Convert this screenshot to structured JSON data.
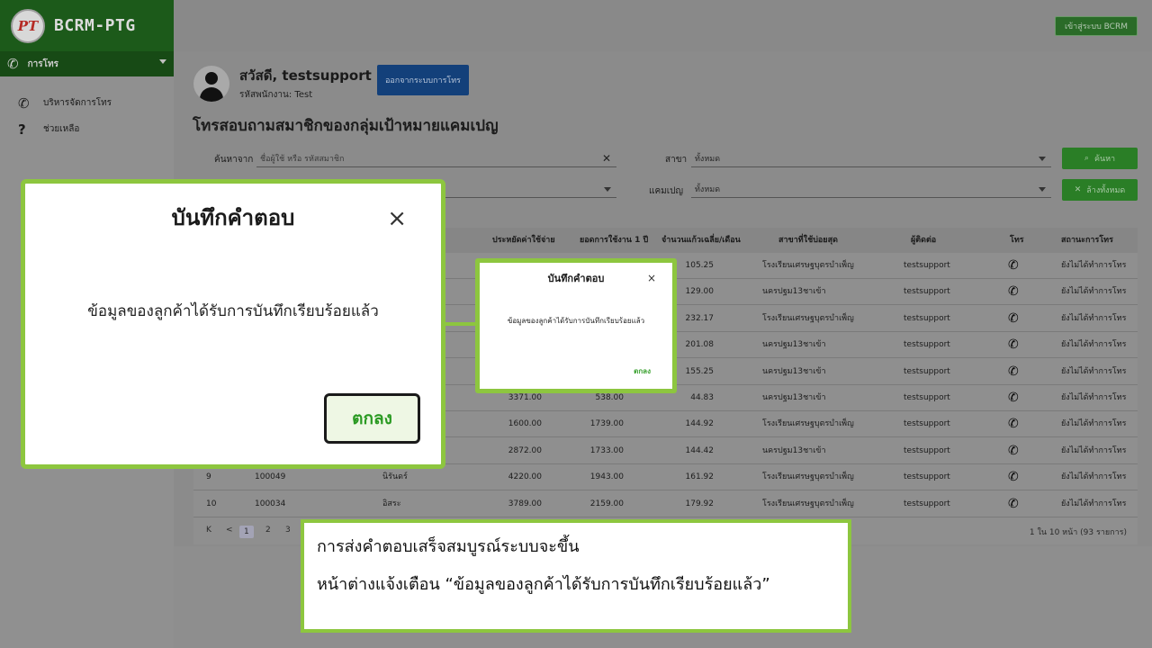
{
  "brand": {
    "logo_text": "PT",
    "name": "BCRM-PTG"
  },
  "sidebar": {
    "header": "การโทร",
    "items": [
      {
        "label": "บริหารจัดการโทร",
        "icon": "phone-icon"
      },
      {
        "label": "ช่วยเหลือ",
        "icon": "help-icon"
      }
    ]
  },
  "topbar": {
    "login_button": "เข้าสู่ระบบ BCRM"
  },
  "user": {
    "greeting": "สวัสดี, testsupport",
    "employee_id": "รหัสพนักงาน: Test",
    "logout_button": "ออกจากระบบการโทร"
  },
  "page": {
    "title": "โทรสอบถามสมาชิกของกลุ่มเป้าหมายแคมเปญ"
  },
  "filters": {
    "search_label": "ค้นหาจาก",
    "search_placeholder": "ชื่อผู้ใช้ หรือ รหัสสมาชิก",
    "branch_label": "สาขา",
    "branch_value": "ทั้งหมด",
    "campaign_label": "แคมเปญ",
    "campaign_value": "ทั้งหมด",
    "search_button": "ค้นหา",
    "clear_button": "ล้างทั้งหมด"
  },
  "table": {
    "headers": [
      "ประหยัดค่าใช้จ่าย",
      "ยอดการใช้งาน 1 ปี",
      "จำนวนแก้วเฉลี่ย/เดือน",
      "สาขาที่ใช้บ่อยสุด",
      "ผู้ติดต่อ",
      "โทร",
      "สถานะการโทร"
    ],
    "rows": [
      {
        "no": "",
        "id": "",
        "name": "",
        "saving": "",
        "usage": "",
        "avg": "105.25",
        "branch": "โรงเรียนเศรษฐบุตรบำเพ็ญ",
        "contact": "testsupport",
        "status": "ยังไม่ได้ทำการโทร"
      },
      {
        "no": "",
        "id": "",
        "name": "",
        "saving": "",
        "usage": "",
        "avg": "129.00",
        "branch": "นครปฐม13ชาเข้า",
        "contact": "testsupport",
        "status": "ยังไม่ได้ทำการโทร"
      },
      {
        "no": "",
        "id": "",
        "name": "",
        "saving": "",
        "usage": "",
        "avg": "232.17",
        "branch": "โรงเรียนเศรษฐบุตรบำเพ็ญ",
        "contact": "testsupport",
        "status": "ยังไม่ได้ทำการโทร"
      },
      {
        "no": "",
        "id": "",
        "name": "",
        "saving": "",
        "usage": "",
        "avg": "201.08",
        "branch": "นครปฐม13ชาเข้า",
        "contact": "testsupport",
        "status": "ยังไม่ได้ทำการโทร"
      },
      {
        "no": "",
        "id": "",
        "name": "",
        "saving": "",
        "usage": "",
        "avg": "155.25",
        "branch": "นครปฐม13ชาเข้า",
        "contact": "testsupport",
        "status": "ยังไม่ได้ทำการโทร"
      },
      {
        "no": "",
        "id": "",
        "name": "",
        "saving": "3371.00",
        "usage": "538.00",
        "avg": "44.83",
        "branch": "นครปฐม13ชาเข้า",
        "contact": "testsupport",
        "status": "ยังไม่ได้ทำการโทร"
      },
      {
        "no": "",
        "id": "",
        "name": "",
        "saving": "1600.00",
        "usage": "1739.00",
        "avg": "144.92",
        "branch": "โรงเรียนเศรษฐบุตรบำเพ็ญ",
        "contact": "testsupport",
        "status": "ยังไม่ได้ทำการโทร"
      },
      {
        "no": "",
        "id": "",
        "name": "",
        "saving": "2872.00",
        "usage": "1733.00",
        "avg": "144.42",
        "branch": "นครปฐม13ชาเข้า",
        "contact": "testsupport",
        "status": "ยังไม่ได้ทำการโทร"
      },
      {
        "no": "9",
        "id": "100049",
        "name": "นิรันดร์",
        "saving": "4220.00",
        "usage": "1943.00",
        "avg": "161.92",
        "branch": "โรงเรียนเศรษฐบุตรบำเพ็ญ",
        "contact": "testsupport",
        "status": "ยังไม่ได้ทำการโทร"
      },
      {
        "no": "10",
        "id": "100034",
        "name": "อิสระ",
        "saving": "3789.00",
        "usage": "2159.00",
        "avg": "179.92",
        "branch": "โรงเรียนเศรษฐบุตรบำเพ็ญ",
        "contact": "testsupport",
        "status": "ยังไม่ได้ทำการโทร"
      }
    ]
  },
  "pagination": {
    "first": "K",
    "prev": "<",
    "pages": [
      "1",
      "2",
      "3"
    ],
    "info": "1 ใน 10 หน้า (93 รายการ)"
  },
  "dialog": {
    "title": "บันทึกคำตอบ",
    "close": "×",
    "message": "ข้อมูลของลูกค้าได้รับการบันทึกเรียบร้อยแล้ว",
    "ok_button": "ตกลง"
  },
  "caption": {
    "line1": "การส่งคำตอบเสร็จสมบูรณ์ระบบจะขึ้น",
    "line2": "หน้าต่างแจ้งเตือน “ข้อมูลของลูกค้าได้รับการบันทึกเรียบร้อยแล้ว”"
  },
  "colors": {
    "highlight": "#8dc63f",
    "brand_green": "#1c5a1a",
    "logout_blue": "#13407a"
  }
}
